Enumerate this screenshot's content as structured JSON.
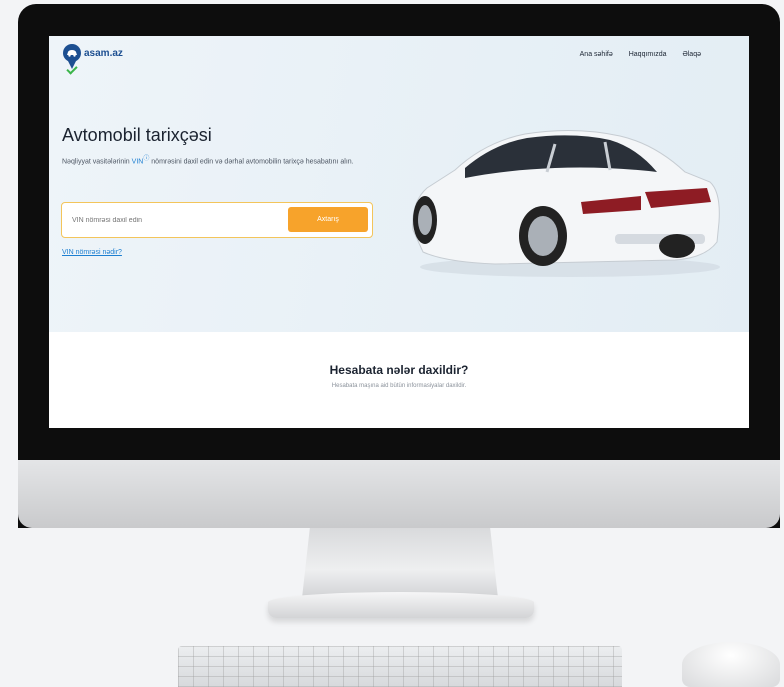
{
  "brand": {
    "name": "asam.az"
  },
  "nav": {
    "items": [
      "Ana səhifə",
      "Haqqımızda",
      "Əlaqə"
    ]
  },
  "hero": {
    "title": "Avtomobil tarixçəsi",
    "desc_before": "Nəqliyyat vasitələrinin ",
    "desc_vin": "VIN",
    "desc_after": " nömrəsini daxil edin və dərhal avtomobilin tarixçə hesabatını alın."
  },
  "search": {
    "placeholder": "VIN nömrəsi daxil edin",
    "button_label": "Axtarış"
  },
  "help_link": "VIN nömrəsi nədir?",
  "section": {
    "title": "Hesabata nələr daxildir?",
    "subtitle": "Hesabata maşına aid bütün informasiyalar daxildir."
  },
  "colors": {
    "accent": "#f7a32b",
    "brand": "#1d4f91",
    "link": "#1d7fd1",
    "input_border": "#f3c55b"
  }
}
